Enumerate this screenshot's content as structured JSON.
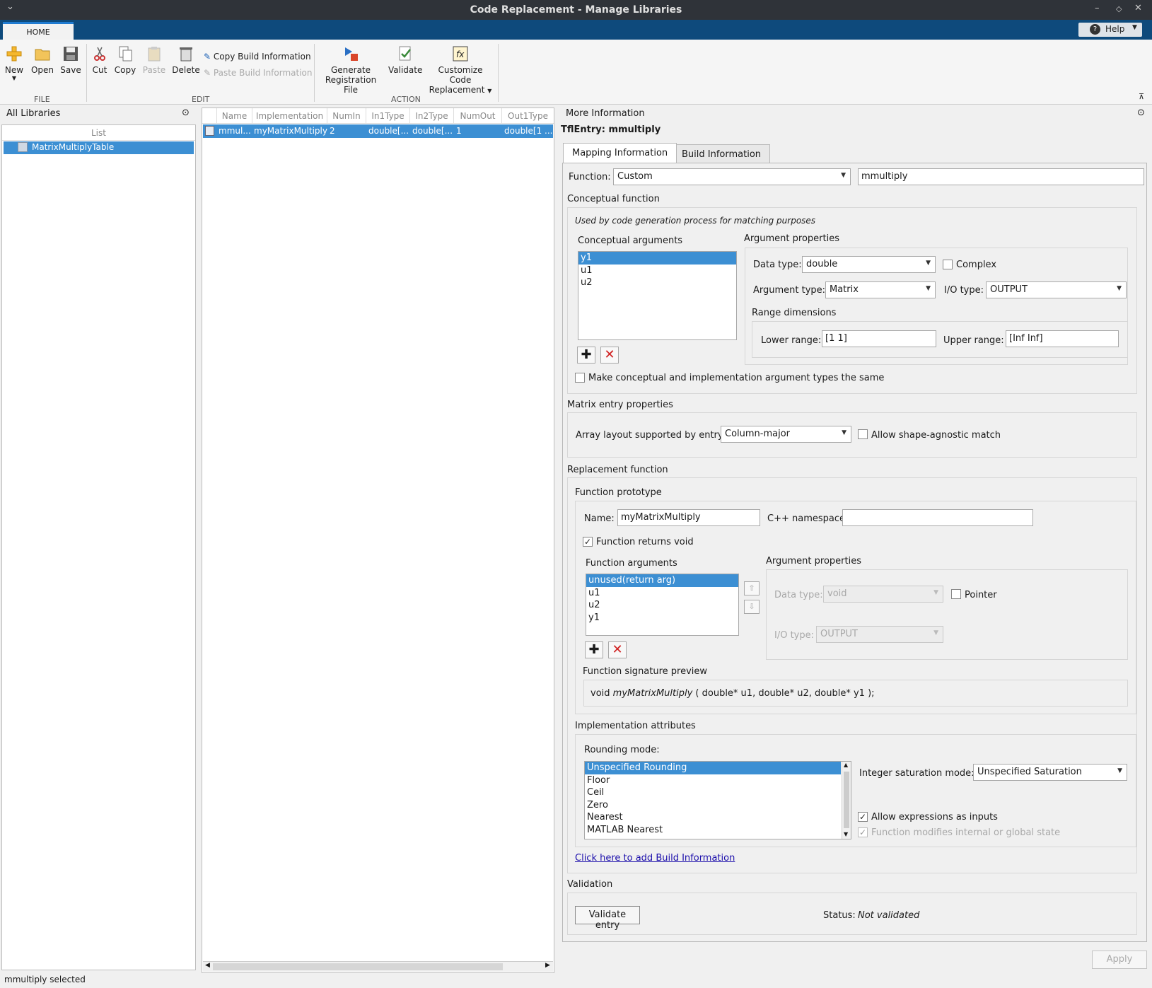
{
  "window": {
    "title": "Code Replacement - Manage Libraries",
    "chevron": "⌄"
  },
  "tabs": {
    "home": "HOME",
    "help": "Help"
  },
  "ribbon": {
    "file": {
      "label": "FILE",
      "new": "New",
      "open": "Open",
      "save": "Save"
    },
    "edit": {
      "label": "EDIT",
      "cut": "Cut",
      "copy": "Copy",
      "paste": "Paste",
      "delete": "Delete",
      "copy_build": "Copy Build Information",
      "paste_build": "Paste Build Information"
    },
    "action": {
      "label": "ACTION",
      "generate": [
        "Generate",
        "Registration File"
      ],
      "validate": "Validate",
      "customize": [
        "Customize Code",
        "Replacement"
      ]
    }
  },
  "left": {
    "title": "All Libraries",
    "list_header": "List",
    "items": [
      "MatrixMultiplyTable"
    ]
  },
  "table": {
    "headers": [
      "Name",
      "Implementation",
      "NumIn",
      "In1Type",
      "In2Type",
      "NumOut",
      "Out1Type"
    ],
    "rows": [
      [
        "mmul...",
        "myMatrixMultiply",
        "2",
        "double[...",
        "double[...",
        "1",
        "double[1 ..."
      ]
    ]
  },
  "info": {
    "header": "More Information",
    "entry": "TflEntry: mmultiply",
    "tabs": [
      "Mapping Information",
      "Build Information"
    ],
    "function_label": "Function:",
    "function_value": "Custom",
    "function_name": "mmultiply",
    "conceptual": {
      "title": "Conceptual function",
      "note": "Used by code generation process for matching purposes",
      "args_label": "Conceptual arguments",
      "args": [
        "y1",
        "u1",
        "u2"
      ],
      "props_label": "Argument properties",
      "data_type_label": "Data type:",
      "data_type": "double",
      "complex_label": "Complex",
      "arg_type_label": "Argument type:",
      "arg_type": "Matrix",
      "io_type_label": "I/O type:",
      "io_type": "OUTPUT",
      "range_label": "Range dimensions",
      "lower_label": "Lower range:",
      "lower": "[1  1]",
      "upper_label": "Upper range:",
      "upper": "[Inf  Inf]",
      "same_types": "Make conceptual and implementation argument types the same"
    },
    "matrix": {
      "title": "Matrix entry properties",
      "layout_label": "Array layout supported by entry:",
      "layout": "Column-major",
      "shape_label": "Allow shape-agnostic match"
    },
    "replacement": {
      "title": "Replacement function",
      "proto_label": "Function prototype",
      "name_label": "Name:",
      "name": "myMatrixMultiply",
      "ns_label": "C++ namespace:",
      "ns": "",
      "returns_void": "Function returns void",
      "args_label": "Function arguments",
      "args": [
        "unused(return arg)",
        "u1",
        "u2",
        "y1"
      ],
      "props_label": "Argument properties",
      "data_type_label": "Data type:",
      "data_type": "void",
      "pointer_label": "Pointer",
      "io_type_label": "I/O type:",
      "io_type": "OUTPUT",
      "sig_label": "Function signature preview",
      "sig_pre": "void ",
      "sig_fn": "myMatrixMultiply",
      "sig_post": " ( double* u1, double* u2, double* y1 );"
    },
    "impl": {
      "title": "Implementation attributes",
      "rounding_label": "Rounding mode:",
      "rounding": [
        "Unspecified Rounding",
        "Floor",
        "Ceil",
        "Zero",
        "Nearest",
        "MATLAB Nearest"
      ],
      "sat_label": "Integer saturation mode:",
      "sat": "Unspecified Saturation",
      "allow_expr": "Allow expressions as inputs",
      "modifies_state": "Function modifies internal or global state"
    },
    "build_link": "Click here to add Build Information",
    "validation": {
      "title": "Validation",
      "button": "Validate entry",
      "status_label": "Status:",
      "status": "Not validated"
    },
    "apply": "Apply"
  },
  "statusbar": "mmultiply selected",
  "colors": {
    "titlebar": "#2f3339",
    "tabstrip": "#0e4a7c",
    "selection": "#3c8fd3",
    "link": "#1a0dab"
  }
}
